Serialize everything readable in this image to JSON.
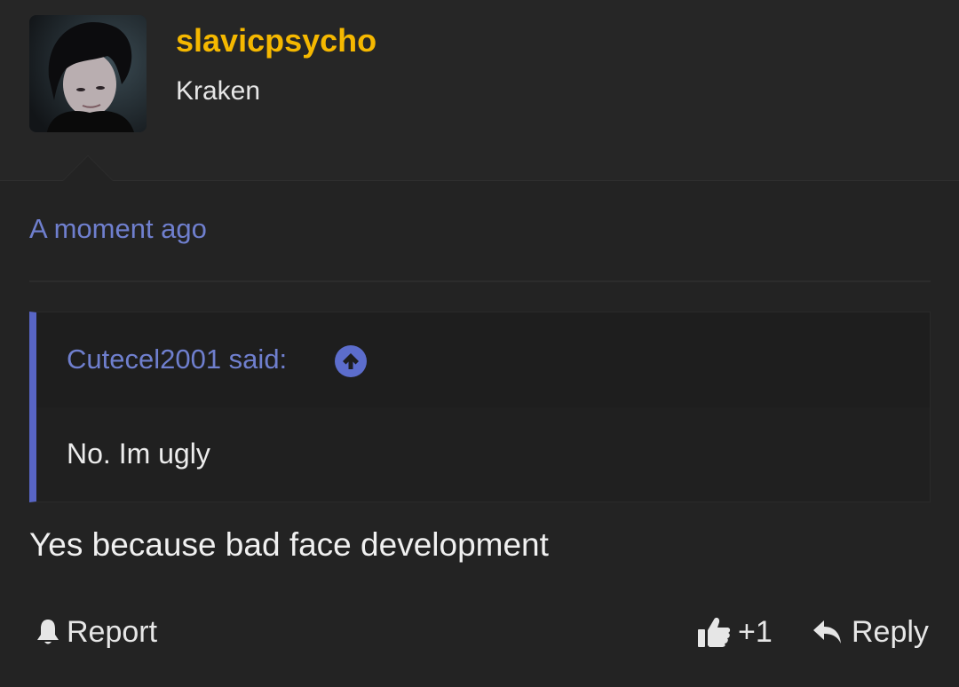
{
  "post": {
    "username": "slavicpsycho",
    "user_title": "Kraken",
    "timestamp": "A moment ago",
    "quote": {
      "author_line": "Cutecel2001 said:",
      "body": "No. Im ugly"
    },
    "message": "Yes because bad face development",
    "actions": {
      "report_label": "Report",
      "like_count": "+1",
      "reply_label": "Reply"
    }
  },
  "colors": {
    "background": "#232323",
    "username": "#f5b800",
    "link_accent": "#6f7fce",
    "quote_bar": "#5865c5"
  },
  "icons": {
    "report": "bell-icon",
    "like": "thumbs-up-icon",
    "reply": "reply-arrow-icon",
    "quote_link": "arrow-up-circle-icon"
  }
}
